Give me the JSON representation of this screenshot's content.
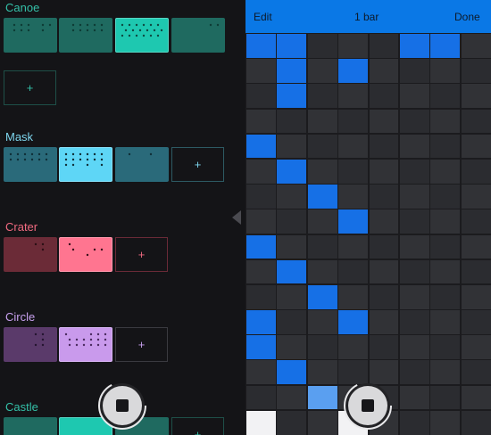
{
  "colors": {
    "accent": "#0a78e6",
    "grid_cell_a": "#2b2c30",
    "grid_cell_b": "#313236",
    "grid_active": "#1670e6",
    "grid_active_light": "#5a9ff0"
  },
  "tracks": [
    {
      "name": "Canoe",
      "color": "#34c0a8",
      "patterns": [
        {
          "bg": "#1f6a60",
          "dot": "#0e3c35",
          "selected": false,
          "dots": [
            [
              0,
              1,
              0,
              1,
              0,
              1,
              0,
              0,
              0,
              1,
              0,
              1
            ],
            [
              0,
              1,
              0,
              1,
              0,
              1,
              0,
              0,
              0,
              1,
              0,
              0
            ]
          ]
        },
        {
          "bg": "#1f6a60",
          "dot": "#0e3c35",
          "selected": false,
          "dots": [
            [
              0,
              0,
              1,
              0,
              1,
              0,
              1,
              0,
              1,
              0,
              1,
              0
            ],
            [
              0,
              0,
              1,
              0,
              1,
              0,
              1,
              0,
              1,
              0,
              1,
              0
            ]
          ]
        },
        {
          "bg": "#1ec8b0",
          "dot": "#0e4a42",
          "selected": true,
          "dots": [
            [
              1,
              0,
              1,
              0,
              1,
              0,
              1,
              0,
              1,
              0,
              1,
              0
            ],
            [
              0,
              1,
              0,
              1,
              0,
              1,
              0,
              1,
              0,
              1,
              0,
              1
            ],
            [
              1,
              0,
              1,
              0,
              1,
              0,
              1,
              0,
              1,
              0,
              1,
              0
            ]
          ]
        },
        {
          "bg": "#1f6a60",
          "dot": "#0e3c35",
          "selected": false,
          "dots": [
            [
              0,
              0,
              0,
              0,
              0,
              0,
              0,
              0,
              0,
              1,
              0,
              1
            ]
          ]
        }
      ],
      "add": {
        "label": "+",
        "col": 0,
        "row": 1,
        "border": "#1e4f48"
      }
    },
    {
      "name": "Mask",
      "color": "#7ed6ee",
      "patterns": [
        {
          "bg": "#2a6a7a",
          "dot": "#0f2f38",
          "selected": false,
          "dots": [
            [
              1,
              0,
              1,
              0,
              1,
              0,
              1,
              0,
              1,
              0,
              1,
              0
            ],
            [
              1,
              0,
              1,
              0,
              1,
              0,
              1,
              0,
              1,
              0,
              1,
              0
            ]
          ]
        },
        {
          "bg": "#5ed6f6",
          "dot": "#0f2f38",
          "selected": true,
          "dots": [
            [
              1,
              0,
              1,
              0,
              1,
              0,
              1,
              0,
              1,
              0,
              1,
              0
            ],
            [
              1,
              0,
              1,
              0,
              1,
              0,
              1,
              0,
              1,
              0,
              1,
              0
            ],
            [
              1,
              0,
              1,
              0,
              0,
              0,
              1,
              0,
              0,
              0,
              1,
              0
            ]
          ]
        },
        {
          "bg": "#2a6a7a",
          "dot": "#0f2f38",
          "selected": false,
          "dots": [
            [
              0,
              0,
              1,
              0,
              0,
              0,
              0,
              0,
              1,
              0,
              0,
              0
            ]
          ]
        }
      ],
      "add": {
        "label": "+",
        "col": 3,
        "row": 0,
        "border": "#2d5a63"
      }
    },
    {
      "name": "Crater",
      "color": "#f06a80",
      "patterns": [
        {
          "bg": "#6b2b37",
          "dot": "#2a0f15",
          "selected": false,
          "dots": [
            [
              0,
              0,
              0,
              0,
              0,
              0,
              0,
              1,
              0,
              1,
              0,
              0
            ],
            [
              0,
              0,
              0,
              0,
              0,
              0,
              0,
              0,
              0,
              1,
              0,
              0
            ]
          ]
        },
        {
          "bg": "#ff7590",
          "dot": "#3a0f1a",
          "selected": true,
          "dots": [
            [
              0,
              1,
              0,
              0,
              0,
              0,
              0,
              0,
              0,
              0,
              0,
              0
            ],
            [
              0,
              0,
              1,
              0,
              0,
              0,
              0,
              0,
              1,
              0,
              1,
              0
            ],
            [
              0,
              0,
              0,
              0,
              0,
              0,
              1,
              0,
              0,
              0,
              0,
              0
            ]
          ]
        }
      ],
      "add": {
        "label": "+",
        "col": 2,
        "row": 0,
        "border": "#6a2a37"
      }
    },
    {
      "name": "Circle",
      "color": "#c7a0ee",
      "patterns": [
        {
          "bg": "#5a3a6a",
          "dot": "#241530",
          "selected": false,
          "dots": [
            [
              0,
              0,
              0,
              0,
              0,
              0,
              0,
              1,
              0,
              1,
              0,
              0
            ],
            [
              0,
              0,
              0,
              0,
              0,
              0,
              0,
              0,
              0,
              1,
              0,
              0
            ],
            [
              0,
              0,
              0,
              0,
              0,
              0,
              0,
              1,
              0,
              1,
              0,
              0
            ]
          ]
        },
        {
          "bg": "#c99aec",
          "dot": "#4a2a60",
          "selected": true,
          "dots": [
            [
              1,
              0,
              0,
              0,
              0,
              0,
              0,
              1,
              0,
              1,
              0,
              1
            ],
            [
              0,
              1,
              0,
              1,
              0,
              1,
              0,
              1,
              0,
              1,
              0,
              1
            ],
            [
              0,
              1,
              0,
              1,
              0,
              1,
              0,
              1,
              0,
              1,
              0,
              1
            ]
          ]
        }
      ],
      "add": {
        "label": "+",
        "col": 2,
        "row": 0,
        "border": "#3a3a40"
      }
    },
    {
      "name": "Castle",
      "color": "#34c0a8",
      "patterns": [
        {
          "bg": "#1f6a60",
          "dot": "#0e3c35",
          "selected": false,
          "dots": []
        },
        {
          "bg": "#1ec8b0",
          "dot": "#0e4a42",
          "selected": true,
          "dots": []
        },
        {
          "bg": "#1f6a60",
          "dot": "#0e3c35",
          "selected": false,
          "dots": []
        }
      ],
      "add": {
        "label": "+",
        "col": 3,
        "row": 0,
        "border": "#1e4f48"
      }
    }
  ],
  "editor": {
    "edit_label": "Edit",
    "bar_label": "1 bar",
    "done_label": "Done",
    "rows": 16,
    "cols": 8,
    "active": [
      [
        0,
        1,
        1,
        0,
        0,
        0,
        0,
        0
      ],
      [
        1,
        0,
        1,
        0,
        1,
        0,
        0,
        0
      ],
      [
        2,
        0,
        1,
        0,
        0,
        0,
        0,
        0
      ],
      [
        3,
        0,
        0,
        0,
        0,
        0,
        0,
        0
      ],
      [
        4,
        1,
        0,
        0,
        0,
        0,
        0,
        0
      ],
      [
        5,
        0,
        1,
        0,
        0,
        0,
        0,
        0
      ],
      [
        6,
        0,
        0,
        1,
        0,
        0,
        0,
        0
      ],
      [
        7,
        0,
        0,
        0,
        1,
        0,
        0,
        0
      ],
      [
        8,
        1,
        0,
        0,
        0,
        0,
        0,
        0
      ],
      [
        9,
        0,
        1,
        0,
        0,
        0,
        0,
        0
      ],
      [
        10,
        0,
        0,
        1,
        0,
        0,
        0,
        0
      ],
      [
        11,
        1,
        0,
        0,
        1,
        0,
        0,
        0
      ],
      [
        12,
        1,
        0,
        0,
        0,
        0,
        0,
        0
      ],
      [
        13,
        0,
        1,
        0,
        0,
        0,
        0,
        0
      ],
      [
        14,
        0,
        0,
        2,
        0,
        0,
        0,
        0
      ],
      [
        15,
        3,
        0,
        0,
        3,
        0,
        0,
        0
      ]
    ],
    "top_row_extra": [
      5,
      6
    ]
  },
  "transport": {
    "stop_label": "Stop"
  }
}
